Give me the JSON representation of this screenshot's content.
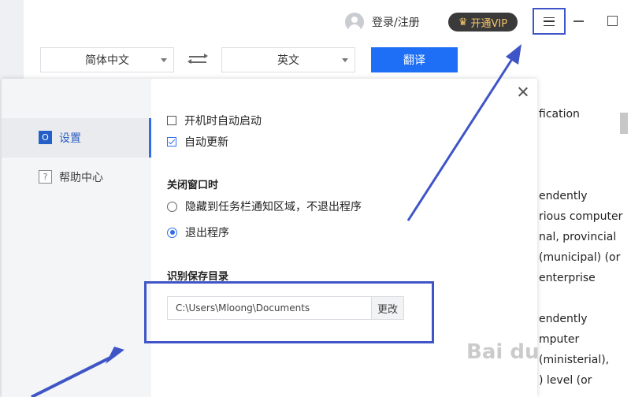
{
  "header": {
    "login_label": "登录/注册",
    "vip_label": "开通VIP"
  },
  "translate_bar": {
    "source_lang": "简体中文",
    "target_lang": "英文",
    "translate_label": "翻译"
  },
  "document": {
    "lines": [
      "fication",
      "endently",
      "rious computer",
      "nal, provincial",
      "(municipal) (or",
      "enterprise",
      "endently",
      "mputer",
      "(ministerial),",
      ") level (or"
    ]
  },
  "settings": {
    "nav": [
      {
        "label": "设置",
        "icon": "settings-square-icon",
        "active": true
      },
      {
        "label": "帮助中心",
        "icon": "help-question-icon",
        "active": false
      }
    ],
    "options": {
      "autostart_label": "开机时自动启动",
      "autostart_checked": false,
      "autoupdate_label": "自动更新",
      "autoupdate_checked": true
    },
    "close_window": {
      "title": "关闭窗口时",
      "choices": [
        {
          "label": "隐藏到任务栏通知区域，不退出程序",
          "selected": false
        },
        {
          "label": "退出程序",
          "selected": true
        }
      ]
    },
    "save_dir": {
      "title": "识别保存目录",
      "path": "C:\\Users\\Mloong\\Documents",
      "change_label": "更改"
    }
  },
  "colors": {
    "accent": "#1e6ff6",
    "annotation": "#3f55c7"
  },
  "watermark": "Bai du"
}
